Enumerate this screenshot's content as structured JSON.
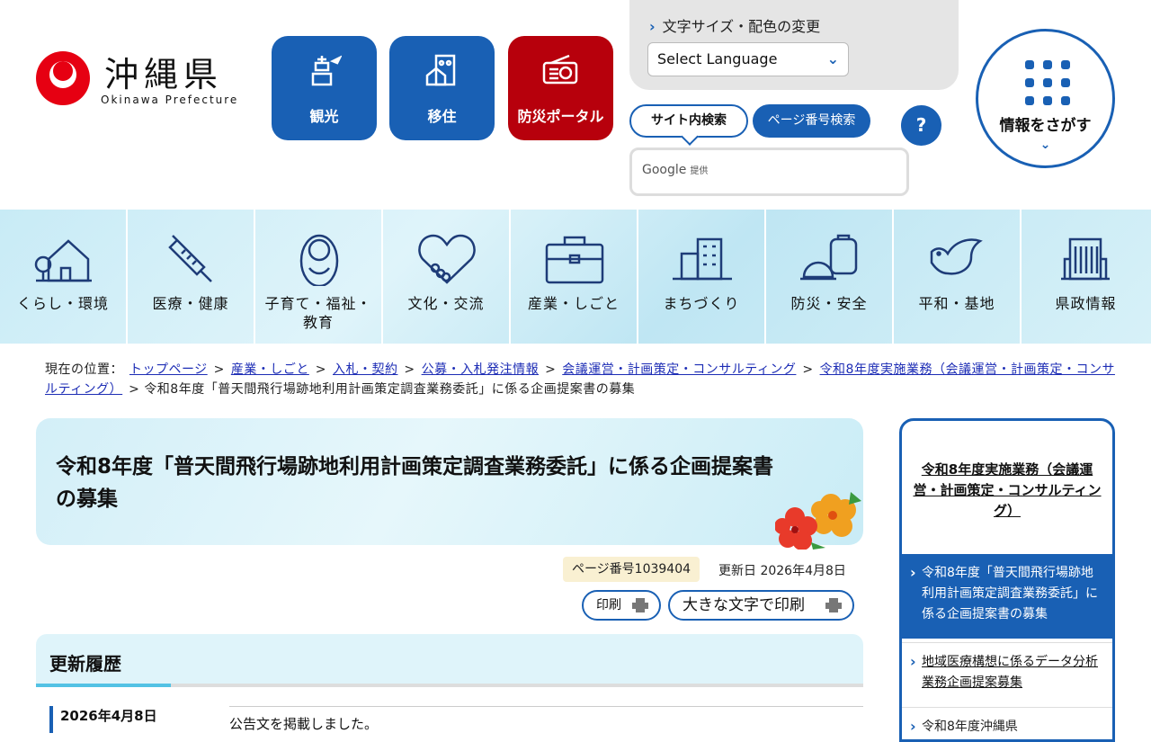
{
  "logo": {
    "jp": "沖縄県",
    "en": "Okinawa Prefecture"
  },
  "quick_links": [
    {
      "label": "観光",
      "icon": "tower-airplane-icon",
      "color": "#1960b4"
    },
    {
      "label": "移住",
      "icon": "house-building-icon",
      "color": "#1960b4"
    },
    {
      "label": "防災ポータル",
      "icon": "radio-icon",
      "color": "#b7000c"
    }
  ],
  "tools": {
    "font_color_link": "文字サイズ・配色の変更",
    "language_select": "Select Language",
    "search_tab_site": "サイト内検索",
    "search_tab_page": "ページ番号検索",
    "help": "?",
    "search_provider": "Google",
    "search_provider_suffix": "提供"
  },
  "info_search": {
    "label": "情報をさがす"
  },
  "global_nav": [
    {
      "label": "くらし・環境",
      "icon": "house-tree-icon"
    },
    {
      "label": "医療・健康",
      "icon": "syringe-icon"
    },
    {
      "label": "子育て・福祉・教育",
      "icon": "baby-icon"
    },
    {
      "label": "文化・交流",
      "icon": "handshake-heart-icon"
    },
    {
      "label": "産業・しごと",
      "icon": "briefcase-icon"
    },
    {
      "label": "まちづくり",
      "icon": "buildings-icon"
    },
    {
      "label": "防災・安全",
      "icon": "helmet-bag-icon"
    },
    {
      "label": "平和・基地",
      "icon": "dove-icon"
    },
    {
      "label": "県政情報",
      "icon": "government-building-icon"
    }
  ],
  "breadcrumb": {
    "prefix": "現在の位置：",
    "links": [
      "トップページ",
      "産業・しごと",
      "入札・契約",
      "公募・入札発注情報",
      "会議運営・計画策定・コンサルティング",
      "令和8年度実施業務（会議運営・計画策定・コンサルティング）"
    ],
    "separator": ">",
    "current": "令和8年度「普天間飛行場跡地利用計画策定調査業務委託」に係る企画提案書の募集"
  },
  "page": {
    "title": "令和8年度「普天間飛行場跡地利用計画策定調査業務委託」に係る企画提案書の募集",
    "page_number": "ページ番号1039404",
    "updated": "更新日 2026年4月8日",
    "print": "印刷",
    "print_large": "大きな文字で印刷",
    "history_heading": "更新履歴",
    "history_date": "2026年4月8日",
    "history_text": "公告文を掲載しました。"
  },
  "sidebar": {
    "heading": "令和8年度実施業務（会議運営・計画策定・コンサルティング）",
    "items": [
      "令和8年度「普天間飛行場跡地利用計画策定調査業務委託」に係る企画提案書の募集",
      "地域医療構想に係るデータ分析業務企画提案募集",
      "令和8年度沖縄県"
    ]
  },
  "colors": {
    "primary": "#1960b4",
    "disaster_red": "#b7000c",
    "brand_red": "#e60012",
    "nav_bg": "#c8ebf6"
  }
}
